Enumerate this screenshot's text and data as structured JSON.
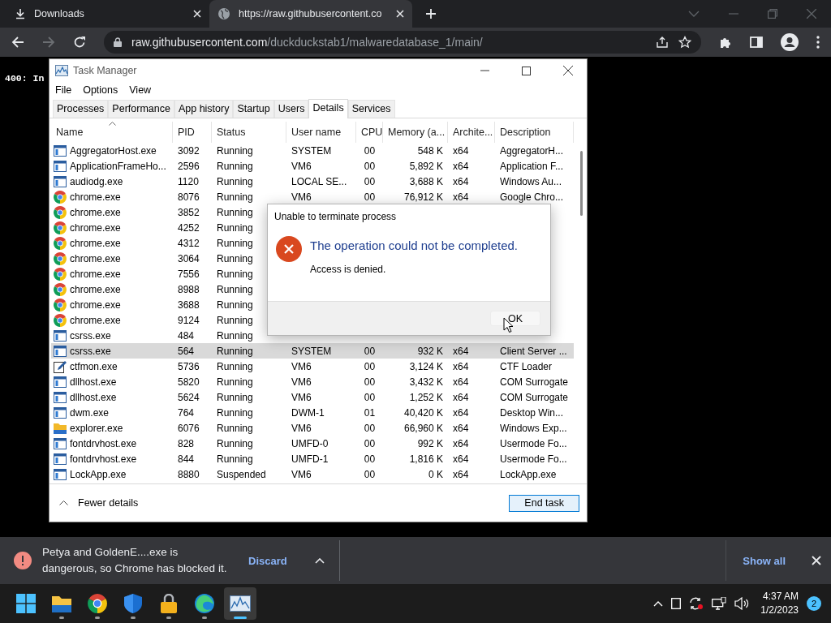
{
  "browser": {
    "tabs": [
      {
        "label": "Downloads",
        "selected": false
      },
      {
        "label": "https://raw.githubusercontent.co",
        "selected": true
      }
    ],
    "address": {
      "host": "raw.githubusercontent.com",
      "path": "/duckduckstab1/malwaredatabase_1/main/"
    },
    "page_text": "400: In"
  },
  "task_manager": {
    "title": "Task Manager",
    "menu": [
      "File",
      "Options",
      "View"
    ],
    "tabs": [
      {
        "label": "Processes",
        "selected": false
      },
      {
        "label": "Performance",
        "selected": false
      },
      {
        "label": "App history",
        "selected": false
      },
      {
        "label": "Startup",
        "selected": false
      },
      {
        "label": "Users",
        "selected": false
      },
      {
        "label": "Details",
        "selected": true
      },
      {
        "label": "Services",
        "selected": false
      }
    ],
    "columns": [
      {
        "label": "Name",
        "sorted": true
      },
      {
        "label": "PID",
        "sorted": false
      },
      {
        "label": "Status",
        "sorted": false
      },
      {
        "label": "User name",
        "sorted": false
      },
      {
        "label": "CPU",
        "sorted": false
      },
      {
        "label": "Memory (a...",
        "sorted": false
      },
      {
        "label": "Archite...",
        "sorted": false
      },
      {
        "label": "Description",
        "sorted": false
      }
    ],
    "rows": [
      {
        "kind": "app",
        "selected": false,
        "cells": [
          "AggregatorHost.exe",
          "3092",
          "Running",
          "SYSTEM",
          "00",
          "548 K",
          "x64",
          "AggregatorH..."
        ]
      },
      {
        "kind": "app",
        "selected": false,
        "cells": [
          "ApplicationFrameHo...",
          "2596",
          "Running",
          "VM6",
          "00",
          "5,892 K",
          "x64",
          "Application F..."
        ]
      },
      {
        "kind": "app",
        "selected": false,
        "cells": [
          "audiodg.exe",
          "1120",
          "Running",
          "LOCAL SE...",
          "00",
          "3,688 K",
          "x64",
          "Windows Au..."
        ]
      },
      {
        "kind": "chrome",
        "selected": false,
        "cells": [
          "chrome.exe",
          "8076",
          "Running",
          "VM6",
          "00",
          "76,912 K",
          "x64",
          "Google Chro..."
        ]
      },
      {
        "kind": "chrome",
        "selected": false,
        "cells": [
          "chrome.exe",
          "3852",
          "Running"
        ]
      },
      {
        "kind": "chrome",
        "selected": false,
        "cells": [
          "chrome.exe",
          "4252",
          "Running"
        ]
      },
      {
        "kind": "chrome",
        "selected": false,
        "cells": [
          "chrome.exe",
          "4312",
          "Running"
        ]
      },
      {
        "kind": "chrome",
        "selected": false,
        "cells": [
          "chrome.exe",
          "3064",
          "Running"
        ]
      },
      {
        "kind": "chrome",
        "selected": false,
        "cells": [
          "chrome.exe",
          "7556",
          "Running"
        ]
      },
      {
        "kind": "chrome",
        "selected": false,
        "cells": [
          "chrome.exe",
          "8988",
          "Running"
        ]
      },
      {
        "kind": "chrome",
        "selected": false,
        "cells": [
          "chrome.exe",
          "3688",
          "Running"
        ]
      },
      {
        "kind": "chrome",
        "selected": false,
        "cells": [
          "chrome.exe",
          "9124",
          "Running"
        ]
      },
      {
        "kind": "app",
        "selected": false,
        "cells": [
          "csrss.exe",
          "484",
          "Running"
        ]
      },
      {
        "kind": "app",
        "selected": true,
        "cells": [
          "csrss.exe",
          "564",
          "Running",
          "SYSTEM",
          "00",
          "932 K",
          "x64",
          "Client Server ..."
        ]
      },
      {
        "kind": "pen",
        "selected": false,
        "cells": [
          "ctfmon.exe",
          "5736",
          "Running",
          "VM6",
          "00",
          "3,124 K",
          "x64",
          "CTF Loader"
        ]
      },
      {
        "kind": "app",
        "selected": false,
        "cells": [
          "dllhost.exe",
          "5820",
          "Running",
          "VM6",
          "00",
          "3,432 K",
          "x64",
          "COM Surrogate"
        ]
      },
      {
        "kind": "app",
        "selected": false,
        "cells": [
          "dllhost.exe",
          "5624",
          "Running",
          "VM6",
          "00",
          "1,252 K",
          "x64",
          "COM Surrogate"
        ]
      },
      {
        "kind": "app",
        "selected": false,
        "cells": [
          "dwm.exe",
          "764",
          "Running",
          "DWM-1",
          "01",
          "40,420 K",
          "x64",
          "Desktop Win..."
        ]
      },
      {
        "kind": "folder",
        "selected": false,
        "cells": [
          "explorer.exe",
          "6076",
          "Running",
          "VM6",
          "00",
          "66,960 K",
          "x64",
          "Windows Exp..."
        ]
      },
      {
        "kind": "app",
        "selected": false,
        "cells": [
          "fontdrvhost.exe",
          "828",
          "Running",
          "UMFD-0",
          "00",
          "992 K",
          "x64",
          "Usermode Fo..."
        ]
      },
      {
        "kind": "app",
        "selected": false,
        "cells": [
          "fontdrvhost.exe",
          "844",
          "Running",
          "UMFD-1",
          "00",
          "1,816 K",
          "x64",
          "Usermode Fo..."
        ]
      },
      {
        "kind": "app",
        "selected": false,
        "cells": [
          "LockApp.exe",
          "8880",
          "Suspended",
          "VM6",
          "00",
          "0 K",
          "x64",
          "LockApp.exe"
        ]
      }
    ],
    "fewer_details": "Fewer details",
    "end_task": "End task"
  },
  "dialog": {
    "title": "Unable to terminate process",
    "heading": "The operation could not be completed.",
    "message": "Access is denied.",
    "button": "OK"
  },
  "download_bar": {
    "message": "Petya and GoldenE....exe is dangerous, so Chrome has blocked it.",
    "discard": "Discard",
    "show_all": "Show all"
  },
  "taskbar": {
    "apps": [
      {
        "kind": "windows",
        "running": false,
        "selected": false
      },
      {
        "kind": "folder",
        "running": true,
        "selected": false
      },
      {
        "kind": "chrome",
        "running": true,
        "selected": false
      },
      {
        "kind": "shield",
        "running": true,
        "selected": false
      },
      {
        "kind": "padlock",
        "running": true,
        "selected": false
      },
      {
        "kind": "edge",
        "running": true,
        "selected": false
      },
      {
        "kind": "taskmgr",
        "running": true,
        "selected": true
      }
    ],
    "time": "4:37 AM",
    "date": "1/2/2023",
    "notifications": "2"
  }
}
